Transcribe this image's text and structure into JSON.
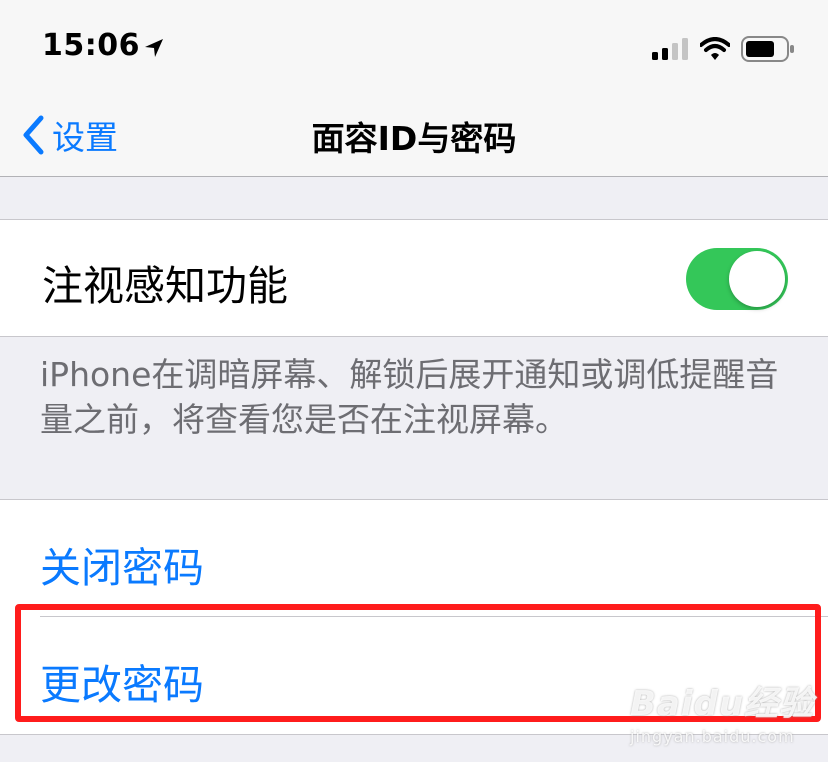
{
  "status_bar": {
    "time": "15:06"
  },
  "nav": {
    "back_label": "设置",
    "title": "面容ID与密码"
  },
  "attention": {
    "label": "注视感知功能",
    "toggle_on": true,
    "footer": "iPhone在调暗屏幕、解锁后展开通知或调低提醒音量之前，将查看您是否在注视屏幕。"
  },
  "passcode": {
    "turn_off_label": "关闭密码",
    "change_label": "更改密码"
  },
  "watermark": {
    "logo": "Baidu经验",
    "url": "jingyan.baidu.com"
  },
  "colors": {
    "accent": "#0a7aff",
    "toggle_on": "#34c759",
    "highlight": "#ff1c1c",
    "background": "#efeff4"
  }
}
